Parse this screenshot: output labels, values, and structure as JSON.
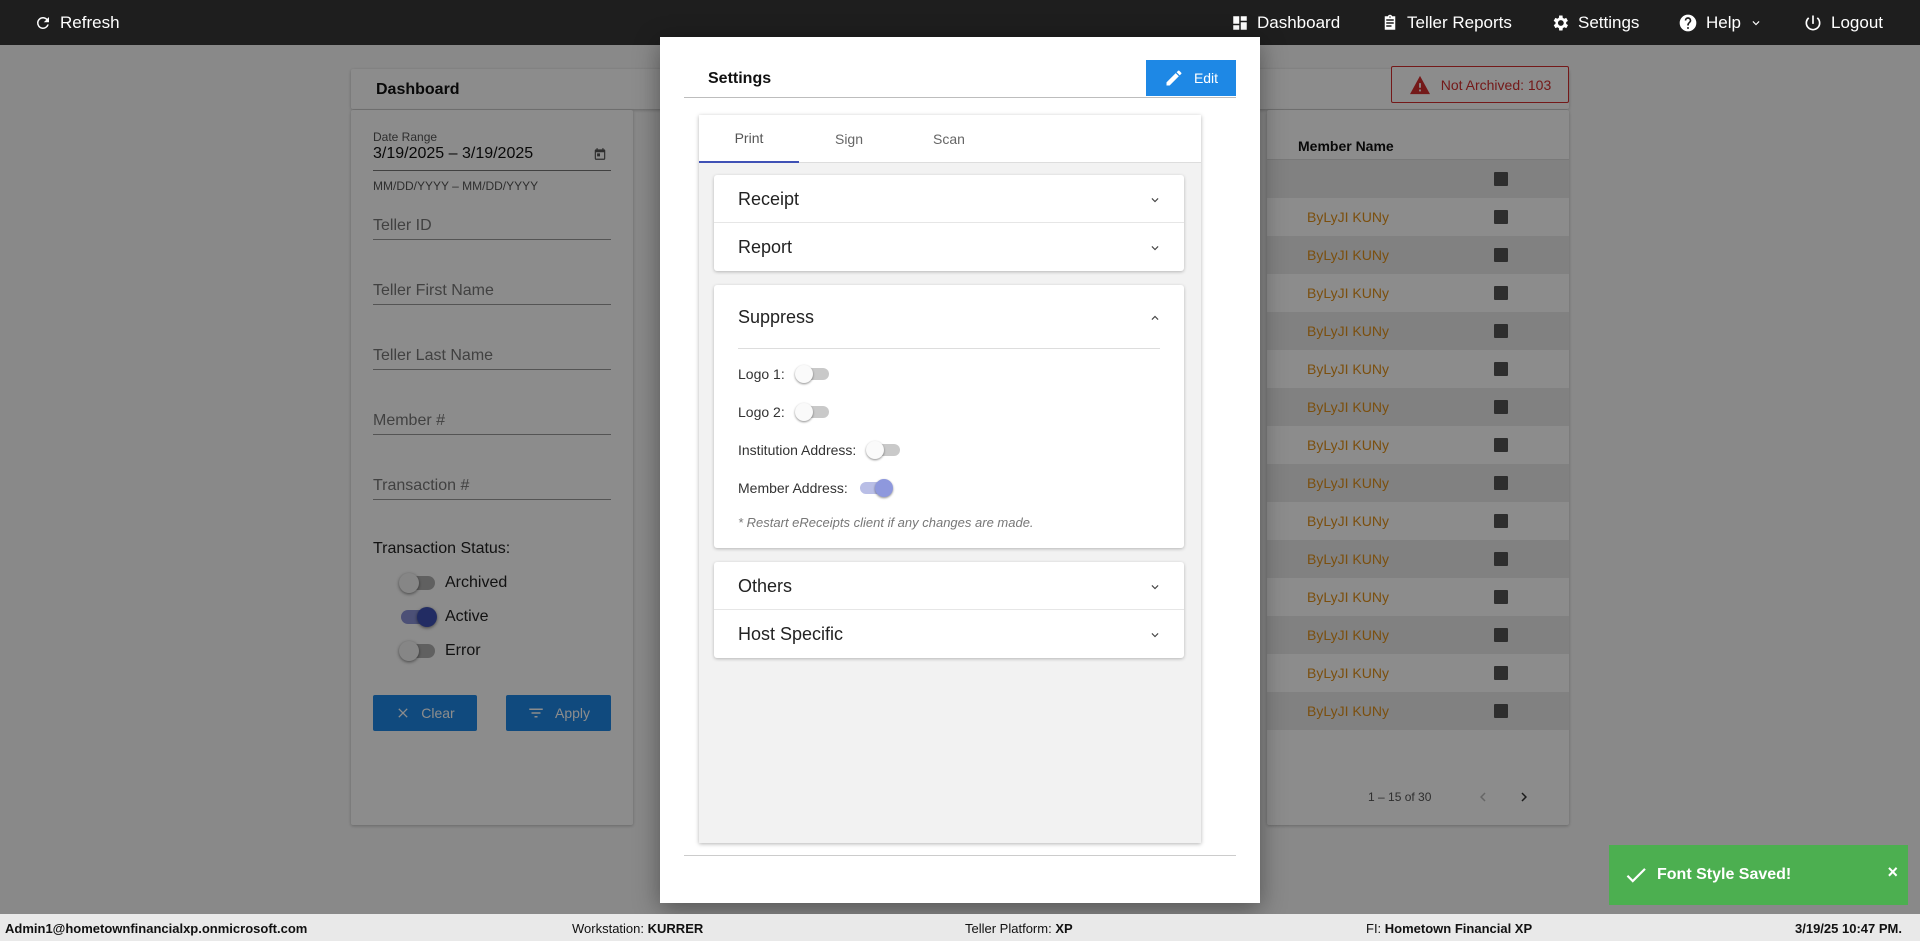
{
  "topbar": {
    "refresh": "Refresh",
    "dashboard": "Dashboard",
    "teller_reports": "Teller Reports",
    "settings": "Settings",
    "help": "Help",
    "logout": "Logout"
  },
  "dashboard": {
    "title": "Dashboard",
    "not_archived": "Not Archived: 103",
    "filters": {
      "date_range_label": "Date Range",
      "date_range_value": "3/19/2025 – 3/19/2025",
      "date_hint": "MM/DD/YYYY – MM/DD/YYYY",
      "teller_id": "Teller ID",
      "teller_first_name": "Teller First Name",
      "teller_last_name": "Teller Last Name",
      "member_no": "Member #",
      "transaction_no": "Transaction #",
      "status_label": "Transaction Status:",
      "statuses": [
        {
          "label": "Archived",
          "on": false
        },
        {
          "label": "Active",
          "on": true
        },
        {
          "label": "Error",
          "on": false
        }
      ],
      "clear": "Clear",
      "apply": "Apply"
    },
    "table": {
      "member_name_header": "Member Name",
      "rows": [
        "",
        "ByLyJI KUNy",
        "ByLyJI KUNy",
        "ByLyJI KUNy",
        "ByLyJI KUNy",
        "ByLyJI KUNy",
        "ByLyJI KUNy",
        "ByLyJI KUNy",
        "ByLyJI KUNy",
        "ByLyJI KUNy",
        "ByLyJI KUNy",
        "ByLyJI KUNy",
        "ByLyJI KUNy",
        "ByLyJI KUNy",
        "ByLyJI KUNy"
      ],
      "pagination": "1 – 15 of 30"
    }
  },
  "modal": {
    "title": "Settings",
    "edit": "Edit",
    "tabs": [
      "Print",
      "Sign",
      "Scan"
    ],
    "sections": {
      "receipt": "Receipt",
      "report": "Report",
      "suppress": "Suppress",
      "others": "Others",
      "host_specific": "Host Specific"
    },
    "suppress_items": [
      {
        "label": "Logo 1:",
        "on": false
      },
      {
        "label": "Logo 2:",
        "on": false
      },
      {
        "label": "Institution Address:",
        "on": false
      },
      {
        "label": "Member Address:",
        "on": true
      }
    ],
    "note": "* Restart eReceipts client if any changes are made."
  },
  "statusbar": {
    "user": "Admin1@hometownfinancialxp.onmicrosoft.com",
    "workstation_label": "Workstation:",
    "workstation_value": "KURRER",
    "platform_label": "Teller Platform:",
    "platform_value": "XP",
    "fi_label": "FI:",
    "fi_value": "Hometown Financial XP",
    "datetime": "3/19/25 10:47 PM."
  },
  "toast": {
    "message": "Font Style Saved!",
    "close": "×"
  },
  "colors": {
    "accent": "#1e88e5",
    "toggle_on": "#3f51b5",
    "member_name": "#e0901a",
    "toast_bg": "#4caf50",
    "alert": "#d32f2f"
  }
}
